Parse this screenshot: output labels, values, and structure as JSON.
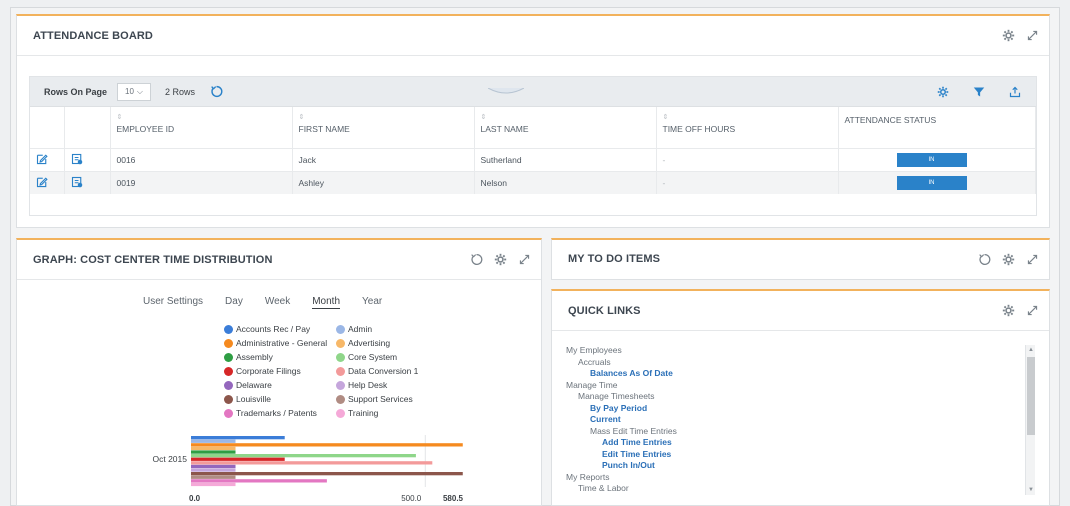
{
  "attendance": {
    "title": "ATTENDANCE BOARD",
    "rows_label": "Rows On Page",
    "rows_value": "10",
    "rows_count": "2 Rows",
    "columns": [
      "EMPLOYEE ID",
      "FIRST NAME",
      "LAST NAME",
      "TIME OFF HOURS",
      "ATTENDANCE STATUS"
    ],
    "rows": [
      {
        "id": "0016",
        "first": "Jack",
        "last": "Sutherland",
        "hours": "-",
        "status": "IN"
      },
      {
        "id": "0019",
        "first": "Ashley",
        "last": "Nelson",
        "hours": "-",
        "status": "IN"
      }
    ]
  },
  "graph": {
    "title": "GRAPH: COST CENTER TIME DISTRIBUTION",
    "tabs": [
      "User Settings",
      "Day",
      "Week",
      "Month",
      "Year"
    ],
    "active_tab": "Month",
    "legend": [
      {
        "label": "Accounts Rec / Pay",
        "color": "#3b7dd8"
      },
      {
        "label": "Admin",
        "color": "#9bb7e6"
      },
      {
        "label": "Administrative - General",
        "color": "#f58a1f"
      },
      {
        "label": "Advertising",
        "color": "#f7b868"
      },
      {
        "label": "Assembly",
        "color": "#2f9e44"
      },
      {
        "label": "Core System",
        "color": "#8fd68a"
      },
      {
        "label": "Corporate Filings",
        "color": "#d62728"
      },
      {
        "label": "Data Conversion 1",
        "color": "#f39a9a"
      },
      {
        "label": "Delaware",
        "color": "#9467bd"
      },
      {
        "label": "Help Desk",
        "color": "#c5a6dc"
      },
      {
        "label": "Louisville",
        "color": "#8c564b"
      },
      {
        "label": "Support Services",
        "color": "#b08c83"
      },
      {
        "label": "Trademarks / Patents",
        "color": "#e377c2"
      },
      {
        "label": "Training",
        "color": "#f5a9d8"
      }
    ]
  },
  "chart_data": {
    "type": "bar",
    "orientation": "horizontal",
    "categories": [
      "Oct 2015"
    ],
    "x_ticks": [
      "0.0",
      "500.0",
      "580.5"
    ],
    "xlim": [
      0,
      580.5
    ],
    "series": [
      {
        "name": "Accounts Rec / Pay",
        "values": [
          200
        ]
      },
      {
        "name": "Admin",
        "values": [
          95
        ]
      },
      {
        "name": "Administrative - General",
        "values": [
          580
        ]
      },
      {
        "name": "Advertising",
        "values": [
          95
        ]
      },
      {
        "name": "Assembly",
        "values": [
          95
        ]
      },
      {
        "name": "Core System",
        "values": [
          480
        ]
      },
      {
        "name": "Corporate Filings",
        "values": [
          200
        ]
      },
      {
        "name": "Data Conversion 1",
        "values": [
          515
        ]
      },
      {
        "name": "Delaware",
        "values": [
          95
        ]
      },
      {
        "name": "Help Desk",
        "values": [
          95
        ]
      },
      {
        "name": "Louisville",
        "values": [
          580
        ]
      },
      {
        "name": "Support Services",
        "values": [
          95
        ]
      },
      {
        "name": "Trademarks / Patents",
        "values": [
          290
        ]
      },
      {
        "name": "Training",
        "values": [
          95
        ]
      }
    ]
  },
  "todo": {
    "title": "MY TO DO ITEMS"
  },
  "quick": {
    "title": "QUICK LINKS",
    "tree": [
      {
        "label": "My Employees",
        "level": 0,
        "link": false
      },
      {
        "label": "Accruals",
        "level": 1,
        "link": false
      },
      {
        "label": "Balances As Of Date",
        "level": 2,
        "link": true
      },
      {
        "label": "Manage Time",
        "level": 0,
        "link": false
      },
      {
        "label": "Manage Timesheets",
        "level": 1,
        "link": false
      },
      {
        "label": "By Pay Period",
        "level": 2,
        "link": true
      },
      {
        "label": "Current",
        "level": 2,
        "link": true
      },
      {
        "label": "Mass Edit Time Entries",
        "level": 2,
        "link": false
      },
      {
        "label": "Add Time Entries",
        "level": 3,
        "link": true
      },
      {
        "label": "Edit Time Entries",
        "level": 3,
        "link": true
      },
      {
        "label": "Punch In/Out",
        "level": 3,
        "link": true
      },
      {
        "label": "My Reports",
        "level": 0,
        "link": false
      },
      {
        "label": "Time & Labor",
        "level": 1,
        "link": false
      }
    ]
  }
}
